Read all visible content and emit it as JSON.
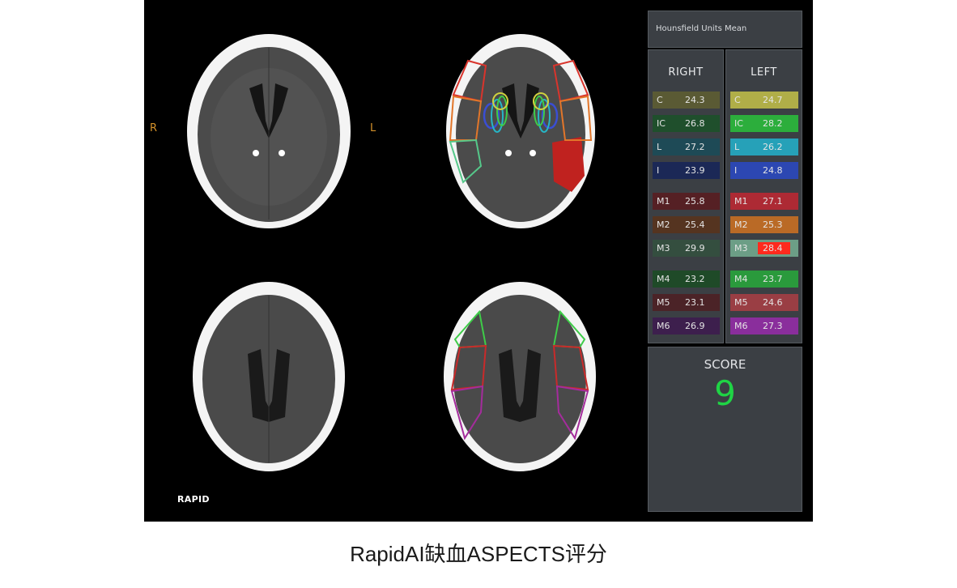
{
  "orientation": {
    "right": "R",
    "left": "L"
  },
  "brand": "RAPID",
  "hu_panel": {
    "title": "Hounsfield Units Mean"
  },
  "columns": {
    "right": {
      "header": "RIGHT",
      "regions": [
        {
          "label": "C",
          "value": "24.3",
          "color": "#5a5a34"
        },
        {
          "label": "IC",
          "value": "26.8",
          "color": "#1f4f2c"
        },
        {
          "label": "L",
          "value": "27.2",
          "color": "#1e4a56"
        },
        {
          "label": "I",
          "value": "23.9",
          "color": "#1b2856"
        },
        {
          "label": "M1",
          "value": "25.8",
          "color": "#552024"
        },
        {
          "label": "M2",
          "value": "25.4",
          "color": "#553420"
        },
        {
          "label": "M3",
          "value": "29.9",
          "color": "#344e3f"
        },
        {
          "label": "M4",
          "value": "23.2",
          "color": "#1f4a28"
        },
        {
          "label": "M5",
          "value": "23.1",
          "color": "#4b2327"
        },
        {
          "label": "M6",
          "value": "26.9",
          "color": "#3d1f4d"
        }
      ]
    },
    "left": {
      "header": "LEFT",
      "regions": [
        {
          "label": "C",
          "value": "24.7",
          "color": "#b0ae48"
        },
        {
          "label": "IC",
          "value": "28.2",
          "color": "#2cae3c"
        },
        {
          "label": "L",
          "value": "26.2",
          "color": "#26a1b8"
        },
        {
          "label": "I",
          "value": "24.8",
          "color": "#2c47b2"
        },
        {
          "label": "M1",
          "value": "27.1",
          "color": "#ad2a34"
        },
        {
          "label": "M2",
          "value": "25.3",
          "color": "#ba6a26"
        },
        {
          "label": "M3",
          "value": "28.4",
          "color": "#6c9e86",
          "flagged": true,
          "flag_color": "#ff2a1d"
        },
        {
          "label": "M4",
          "value": "23.7",
          "color": "#2a9a3c"
        },
        {
          "label": "M5",
          "value": "24.6",
          "color": "#9a3e44"
        },
        {
          "label": "M6",
          "value": "27.3",
          "color": "#8a2e9c"
        }
      ]
    }
  },
  "score": {
    "label": "SCORE",
    "value": "9",
    "color": "#1fd445"
  },
  "caption": "RapidAI缺血ASPECTS评分"
}
